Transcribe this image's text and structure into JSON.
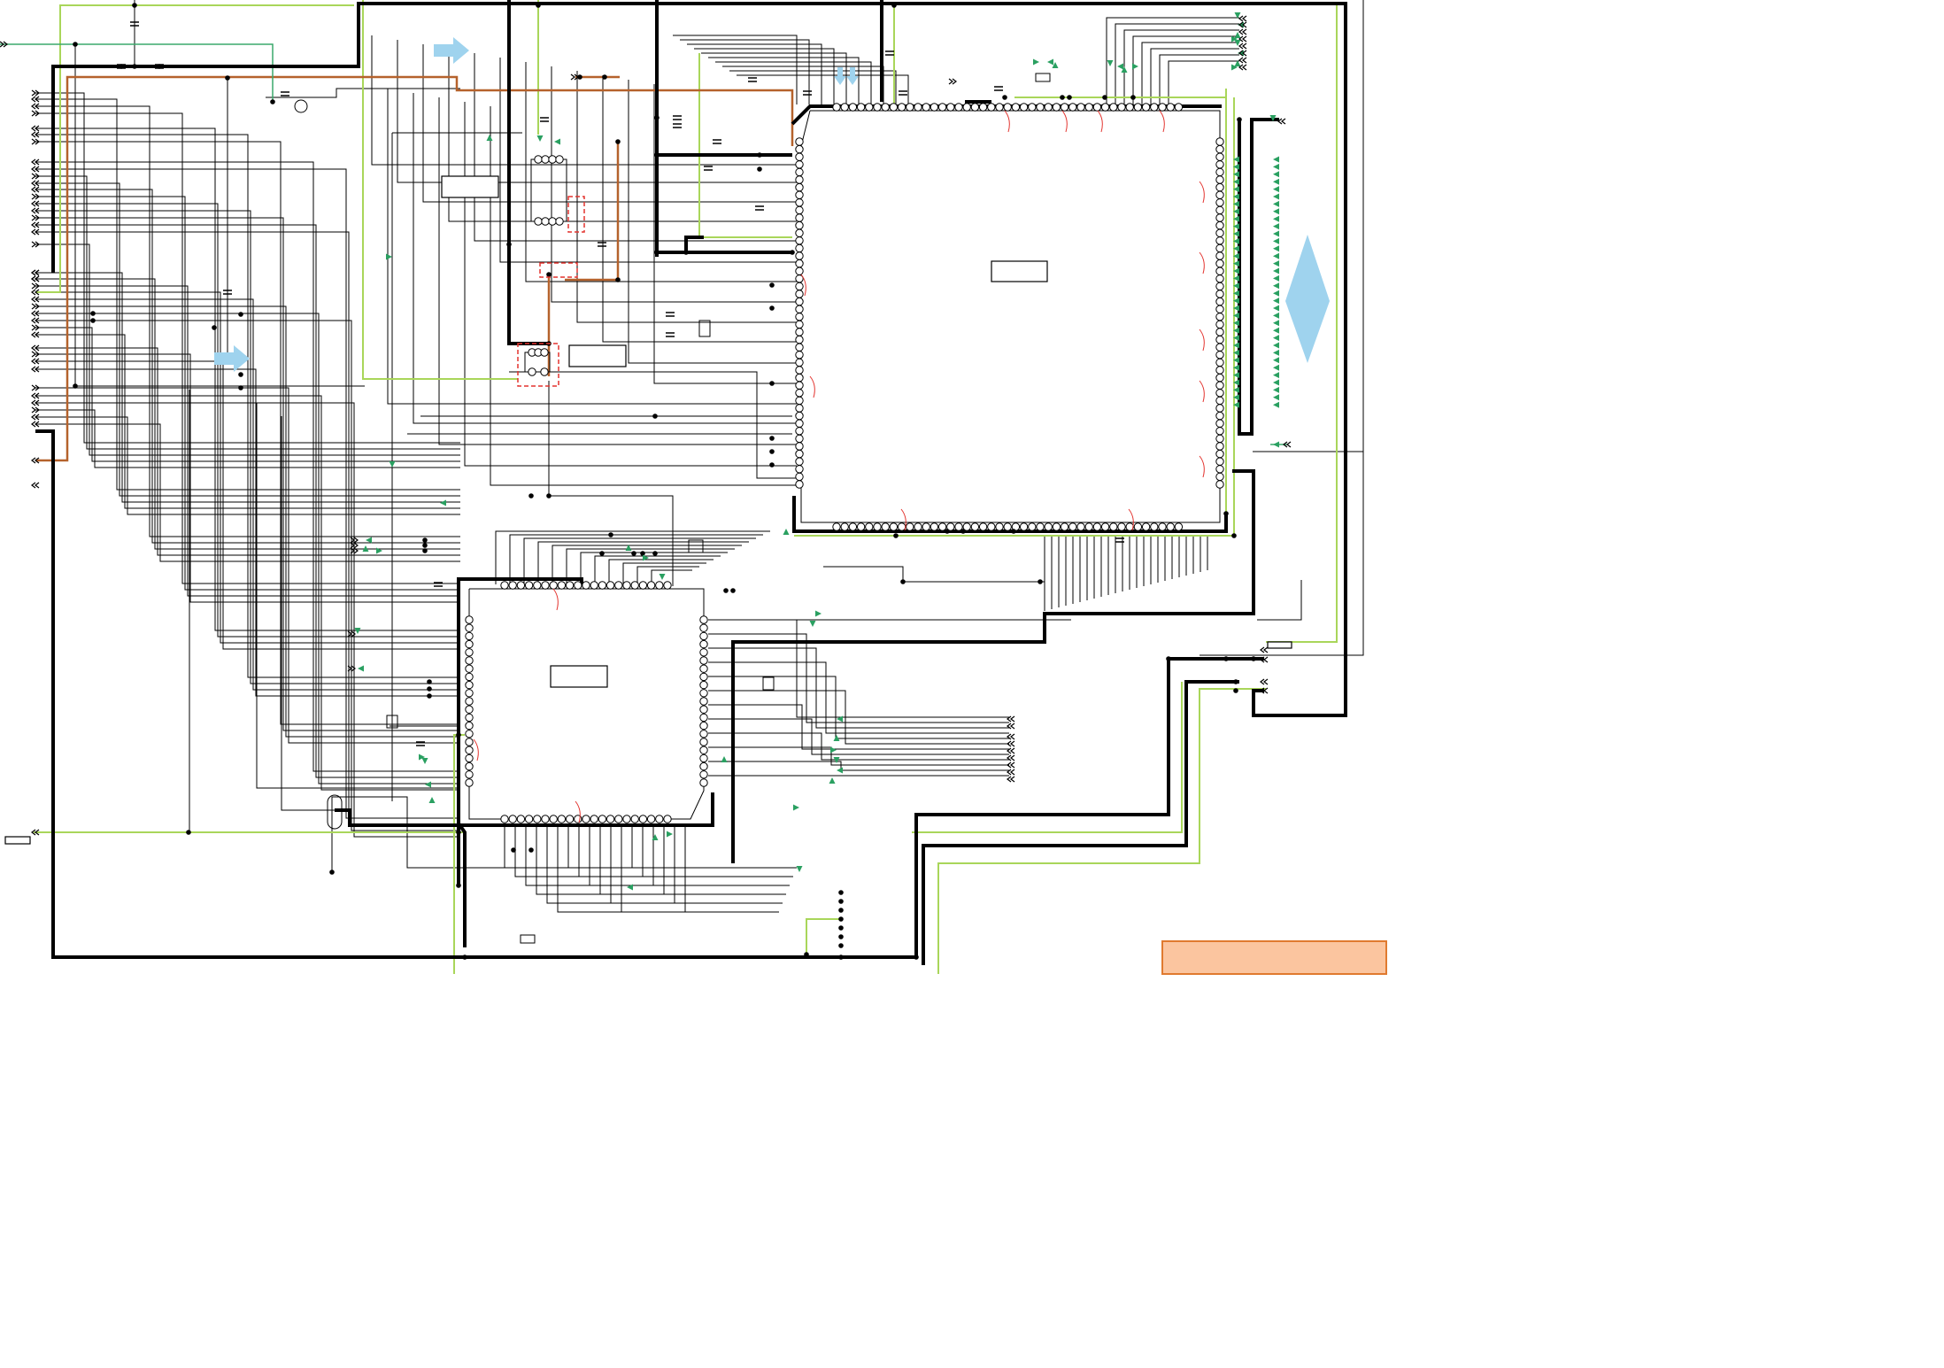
{
  "colors": {
    "wire": "#000000",
    "supply_wire": "#a9d65a",
    "orange_wire": "#b5622c",
    "signal_arrow": "#2aa061",
    "flow_arrow": "#9fd3ee",
    "dashed_box": "#e3342f",
    "legend_fill": "#fbc59f",
    "legend_border": "#e07a2f"
  },
  "icons": {
    "signal_direction": "green-arrow-icon",
    "bus_flow": "light-blue-block-arrow-icon",
    "bidirectional_bus": "light-blue-double-arrow-icon",
    "off_page_connector": "chevron-connector-icon",
    "transistor": "transistor-icon"
  }
}
